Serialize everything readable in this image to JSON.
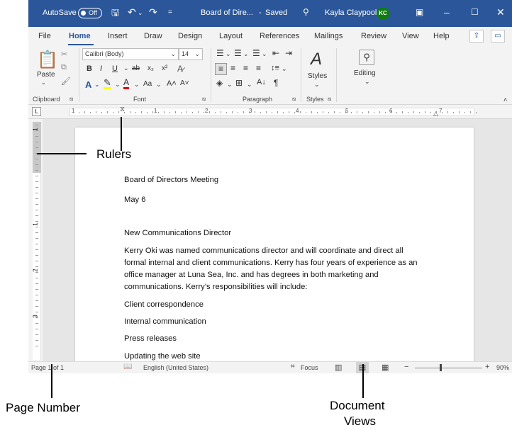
{
  "titlebar": {
    "autosave_label": "AutoSave",
    "autosave_state": "Off",
    "doc_title": "Board of Dire...",
    "save_status": "Saved",
    "user_name": "Kayla Claypool",
    "user_initials": "KC",
    "search_icon": "magnifier-glyph",
    "accent": "#2b579a"
  },
  "tabs": [
    "File",
    "Home",
    "Insert",
    "Draw",
    "Design",
    "Layout",
    "References",
    "Mailings",
    "Review",
    "View",
    "Help"
  ],
  "active_tab": "Home",
  "ribbon": {
    "clipboard": {
      "label": "Clipboard",
      "paste": "Paste"
    },
    "font": {
      "label": "Font",
      "family": "Calibri (Body)",
      "size": "14",
      "bold": "B",
      "italic": "I",
      "underline": "U",
      "strike": "ab",
      "subscript": "x₂",
      "superscript": "x²",
      "change_case": "Aa",
      "grow": "A˄",
      "shrink": "A˅"
    },
    "paragraph": {
      "label": "Paragraph",
      "pilcrow": "¶"
    },
    "styles": {
      "label": "Styles",
      "button": "Styles"
    },
    "editing": {
      "button": "Editing"
    }
  },
  "ruler": {
    "h_numbers": [
      "1",
      "1",
      "2",
      "3",
      "4",
      "5",
      "6",
      "7"
    ],
    "v_numbers": [
      "1",
      "1",
      "2",
      "3"
    ]
  },
  "document": {
    "lines": [
      "Board of Directors Meeting",
      "May 6",
      "New Communications Director",
      "Kerry Oki was named communications director and will coordinate and direct all",
      "formal internal and client communications. Kerry has four years of experience as an",
      "office manager at Luna Sea, Inc. and has degrees in both marketing and",
      "communications. Kerry’s responsibilities will include:",
      "Client correspondence",
      "Internal communication",
      "Press releases",
      "Updating the web site"
    ]
  },
  "status": {
    "page": "Page 1 of 1",
    "language": "English (United States)",
    "focus": "Focus",
    "zoom_minus": "−",
    "zoom_plus": "+",
    "zoom": "90%"
  },
  "callouts": {
    "rulers": "Rulers",
    "page_number": "Page Number",
    "document_views_1": "Document",
    "document_views_2": "Views"
  }
}
